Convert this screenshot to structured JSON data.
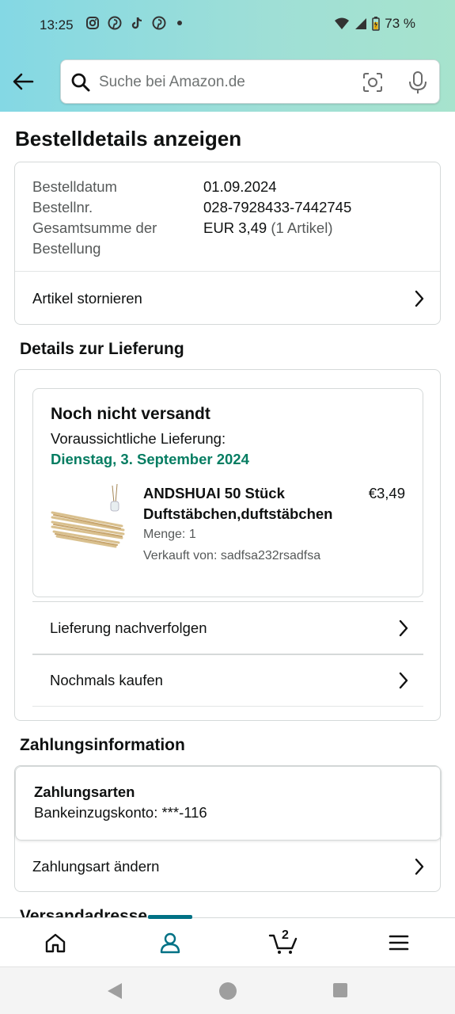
{
  "statusbar": {
    "time": "13:25",
    "battery": "73 %",
    "notification_icons": [
      "instagram-icon",
      "pinterest-icon",
      "tiktok-icon",
      "pinterest-icon"
    ]
  },
  "search": {
    "placeholder": "Suche bei Amazon.de"
  },
  "page": {
    "title": "Bestelldetails anzeigen"
  },
  "order": {
    "date_label": "Bestelldatum",
    "date_value": "01.09.2024",
    "number_label": "Bestellnr.",
    "number_value": "028-7928433-7442745",
    "total_label_1": "Gesamtsumme der",
    "total_label_2": "Bestellung",
    "total_value": "EUR 3,49",
    "total_items": "(1 Artikel)",
    "cancel_label": "Artikel stornieren"
  },
  "delivery": {
    "section_title": "Details zur Lieferung",
    "status": "Noch nicht versandt",
    "eta_label": "Voraussichtliche Lieferung:",
    "eta_date": "Dienstag, 3. September 2024",
    "product": {
      "title_line1": "ANDSHUAI 50 Stück",
      "title_line2": "Duftstäbchen,duftstäbchen",
      "price": "€3,49",
      "quantity": "Menge: 1",
      "seller": "Verkauft von: sadfsa232rsadfsa"
    },
    "track_label": "Lieferung nachverfolgen",
    "buy_again_label": "Nochmals kaufen"
  },
  "payment": {
    "section_title": "Zahlungsinformation",
    "method_title": "Zahlungsarten",
    "method_value": "Bankeinzugskonto: ***-116",
    "change_label": "Zahlungsart ändern"
  },
  "next_section_title": "Versandadresse",
  "bottomnav": {
    "cart_count": "2",
    "active": "account"
  },
  "colors": {
    "accent": "#007185",
    "delivery_green": "#067d62",
    "header_gradient_start": "#84d8e4",
    "header_gradient_end": "#a7e3cd"
  }
}
